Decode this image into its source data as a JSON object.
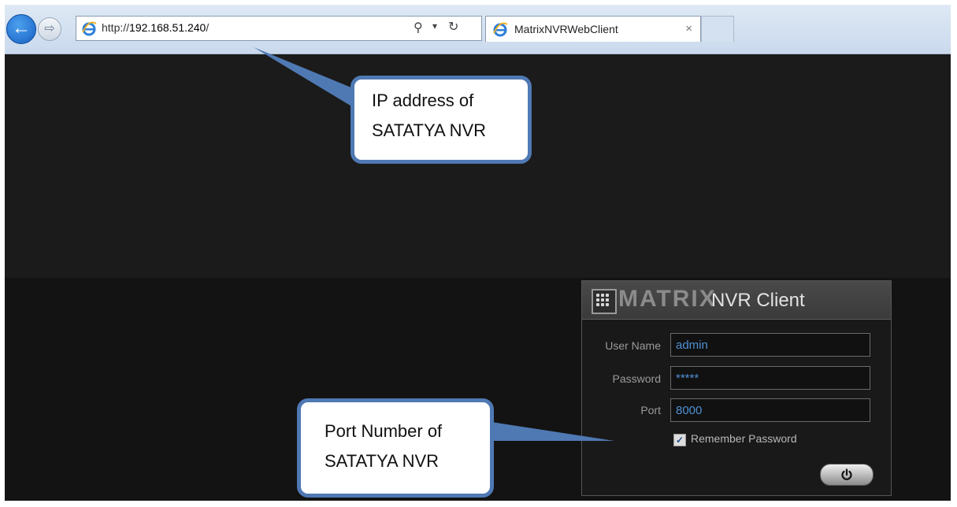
{
  "browser": {
    "url_prefix": "http://",
    "url_host": "192.168.51.240",
    "url_suffix": "/",
    "tab_title": "MatrixNVRWebClient",
    "tab_close": "×"
  },
  "login_panel": {
    "logo_text": "MATRIX",
    "title": "NVR Client",
    "username_label": "User Name",
    "username_value": "admin",
    "password_label": "Password",
    "password_value": "*****",
    "port_label": "Port",
    "port_value": "8000",
    "remember_label": "Remember Password",
    "remember_checked": true,
    "login_icon": "power-icon"
  },
  "callouts": {
    "ip_line1": "IP address of",
    "ip_line2": "SATATYA NVR",
    "port_line1": "Port Number of",
    "port_line2": "SATATYA NVR"
  },
  "colors": {
    "callout_border": "#4f79b3",
    "input_text": "#4f8fd3"
  }
}
